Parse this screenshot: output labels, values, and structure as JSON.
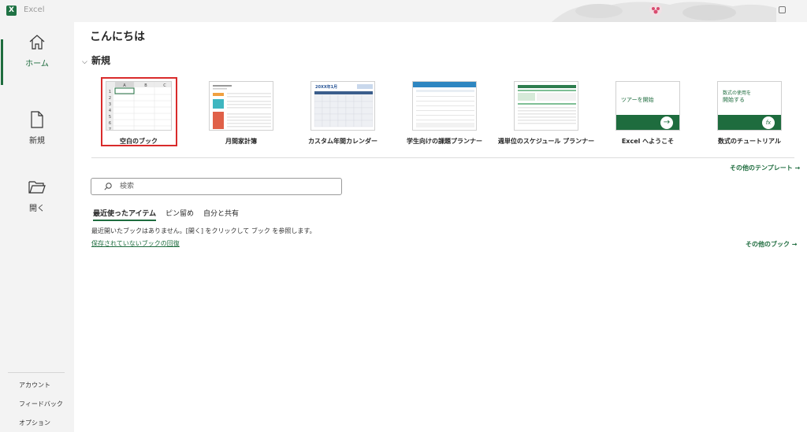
{
  "titlebar": {
    "app_title": "Excel",
    "app_icon": "X"
  },
  "sidebar": {
    "items": [
      {
        "label": "ホーム",
        "icon": "home-icon"
      },
      {
        "label": "新規",
        "icon": "new-document-icon"
      },
      {
        "label": "開く",
        "icon": "open-folder-icon"
      }
    ],
    "bottom": [
      "アカウント",
      "フィードバック",
      "オプション"
    ]
  },
  "main": {
    "greeting": "こんにちは",
    "new_section": {
      "title": "新規"
    },
    "templates": [
      {
        "label": "空白のブック"
      },
      {
        "label": "月間家計簿"
      },
      {
        "label": "カスタム年間カレンダー",
        "thumb_title": "20XX年1月"
      },
      {
        "label": "学生向けの課題プランナー"
      },
      {
        "label": "週単位のスケジュール プランナー"
      },
      {
        "label": "Excel へようこそ",
        "thumb_text": "ツアーを開始"
      },
      {
        "label": "数式のチュートリアル",
        "thumb_text_1": "数式の使用を",
        "thumb_text_2": "開始する",
        "thumb_badge": "fx"
      }
    ],
    "blank_columns": [
      "A",
      "B",
      "C"
    ],
    "blank_rows": [
      "1",
      "2",
      "3",
      "4",
      "5",
      "6",
      "7"
    ],
    "more_templates": "その他のテンプレート →",
    "search": {
      "placeholder": "検索"
    },
    "tabs": [
      "最近使ったアイテム",
      "ピン留め",
      "自分と共有"
    ],
    "empty_message": "最近開いたブックはありません。[開く] をクリックして ブック を参照します。",
    "recover_link": "保存されていないブックの回復",
    "more_books": "その他のブック →"
  },
  "colors": {
    "accent": "#1e6c3e",
    "selected_border": "#d92b2b",
    "sidebar_bg": "#f3f3f3"
  }
}
